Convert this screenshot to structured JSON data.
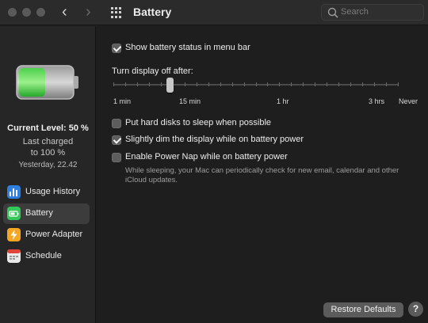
{
  "window": {
    "title": "Battery"
  },
  "search": {
    "placeholder": "Search"
  },
  "sidebar": {
    "current_level": "Current Level: 50 %",
    "last_charged_line1": "Last charged",
    "last_charged_line2": "to 100 %",
    "last_charged_time": "Yesterday, 22.42",
    "battery_level_fraction": 0.5,
    "items": [
      {
        "label": "Usage History",
        "icon": "usage-history-icon",
        "color": "#2f7fe0"
      },
      {
        "label": "Battery",
        "icon": "battery-icon",
        "color": "#34c759",
        "selected": true
      },
      {
        "label": "Power Adapter",
        "icon": "power-adapter-icon",
        "color": "#f5a623"
      },
      {
        "label": "Schedule",
        "icon": "calendar-icon",
        "color": "#e9e9e9"
      }
    ]
  },
  "main": {
    "show_status": {
      "label": "Show battery status in menu bar",
      "checked": true
    },
    "turn_display_off_label": "Turn display off after:",
    "slider": {
      "labels": [
        "1 min",
        "15 min",
        "1 hr",
        "3 hrs",
        "Never"
      ],
      "value": "15 min"
    },
    "hard_disks": {
      "label": "Put hard disks to sleep when possible",
      "checked": false
    },
    "dim_display": {
      "label": "Slightly dim the display while on battery power",
      "checked": true
    },
    "power_nap": {
      "label": "Enable Power Nap while on battery power",
      "checked": false,
      "description": "While sleeping, your Mac can periodically check for new email, calendar and other iCloud updates."
    }
  },
  "footer": {
    "restore_label": "Restore Defaults",
    "help_label": "?"
  },
  "colors": {
    "accent_green": "#34c759",
    "background": "#1e1e1e"
  }
}
